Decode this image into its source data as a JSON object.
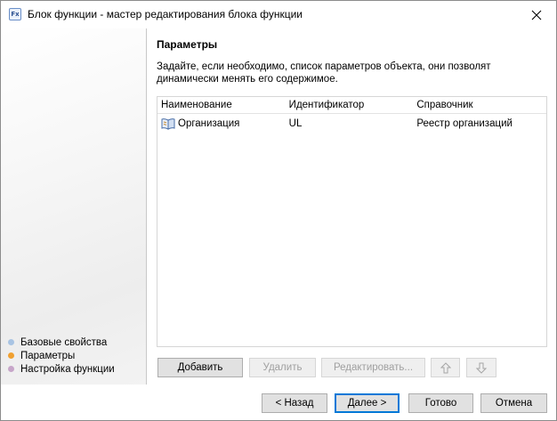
{
  "window": {
    "title": "Блок функции - мастер редактирования блока функции",
    "icon_text": "Fx",
    "icon_name": "function-block-icon"
  },
  "steps": [
    {
      "label": "Базовые свойства",
      "color": "#a9c4e3"
    },
    {
      "label": "Параметры",
      "color": "#f0a030"
    },
    {
      "label": "Настройка функции",
      "color": "#c7a6c9"
    }
  ],
  "page": {
    "heading": "Параметры",
    "description": "Задайте, если необходимо, список параметров объекта, они позволят динамически менять его содержимое."
  },
  "table": {
    "columns": [
      "Наименование",
      "Идентификатор",
      "Справочник"
    ],
    "rows": [
      {
        "name": "Организация",
        "id": "UL",
        "dictionary": "Реестр организаций",
        "icon": "book-icon"
      }
    ]
  },
  "list_buttons": {
    "add": "Добавить",
    "delete": "Удалить",
    "edit": "Редактировать...",
    "up_icon": "arrow-up-icon",
    "down_icon": "arrow-down-icon"
  },
  "footer_buttons": {
    "back": "< Назад",
    "next": "Далее >",
    "finish": "Готово",
    "cancel": "Отмена"
  }
}
